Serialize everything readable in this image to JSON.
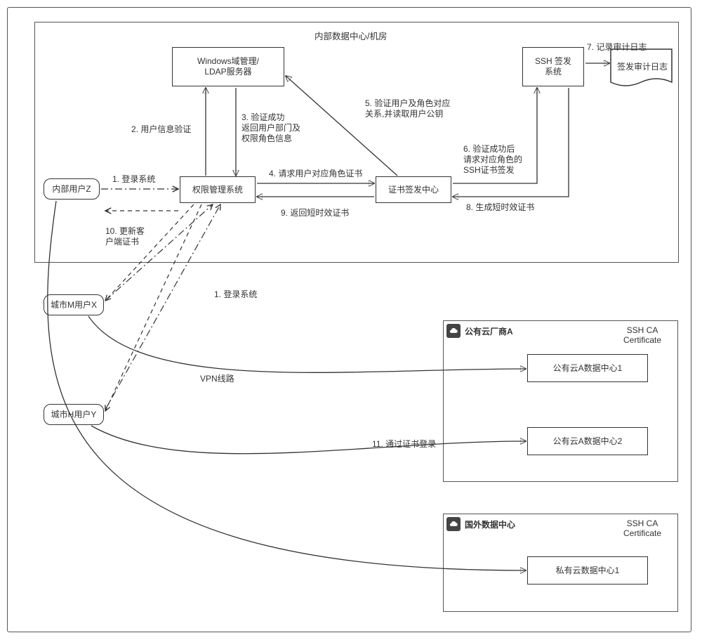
{
  "frames": {
    "datacenter_title": "内部数据中心/机房",
    "cloudA": {
      "title": "公有云厂商A",
      "ca": "SSH CA\nCertificate"
    },
    "foreign": {
      "title": "国外数据中心",
      "ca": "SSH CA\nCertificate"
    }
  },
  "nodes": {
    "ldap": "Windows域管理/\nLDAP服务器",
    "ssh_issue": "SSH 签发\n系统",
    "authsys": "权限管理系统",
    "certcenter": "证书签发中心",
    "auditdoc": "签发审计日志",
    "userZ": "内部用户Z",
    "userMX": "城市M用户X",
    "userHY": "城市H用户Y",
    "cloudA_dc1": "公有云A数据中心1",
    "cloudA_dc2": "公有云A数据中心2",
    "private_dc1": "私有云数据中心1"
  },
  "edges": {
    "e1": "1. 登录系统",
    "e1b": "1. 登录系统",
    "e2": "2. 用户信息验证",
    "e3": "3. 验证成功\n返回用户部门及\n权限角色信息",
    "e4": "4. 请求用户对应角色证书",
    "e5": "5. 验证用户及角色对应\n关系,并读取用户公钥",
    "e6": "6. 验证成功后\n请求对应角色的\nSSH证书签发",
    "e7": "7. 记录审计日志",
    "e8": "8. 生成短时效证书",
    "e9": "9. 返回短时效证书",
    "e10": "10. 更新客\n户端证书",
    "e11": "11. 通过证书登录",
    "vpn": "VPN线路"
  }
}
